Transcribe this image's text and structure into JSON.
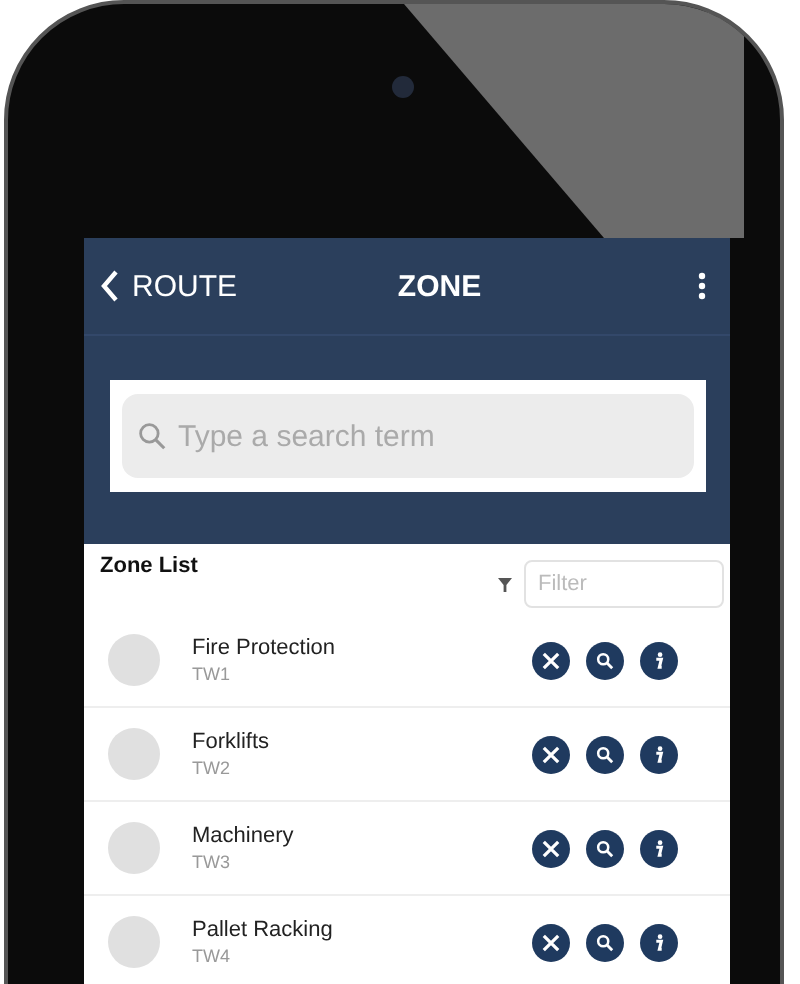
{
  "nav_bar": {
    "back_label": "ROUTE",
    "title": "ZONE"
  },
  "search": {
    "placeholder": "Type a search term"
  },
  "zone_list": {
    "title": "Zone List",
    "filter": {
      "placeholder": "Filter"
    },
    "items": [
      {
        "name": "Fire Protection",
        "code": "TW1"
      },
      {
        "name": "Forklifts",
        "code": "TW2"
      },
      {
        "name": "Machinery",
        "code": "TW3"
      },
      {
        "name": "Pallet Racking",
        "code": "TW4"
      }
    ]
  }
}
